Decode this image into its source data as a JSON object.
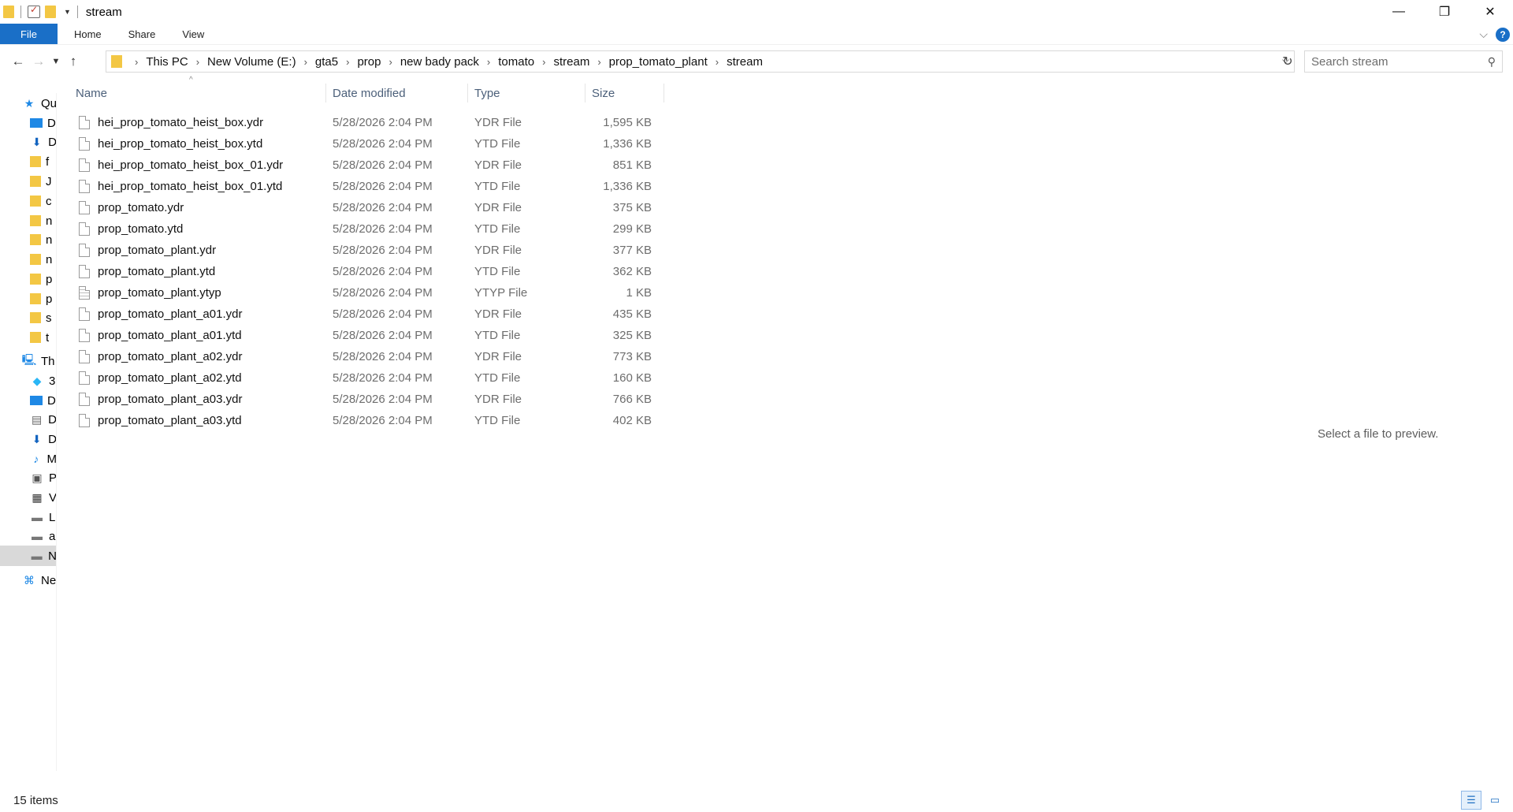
{
  "window": {
    "title": "stream"
  },
  "ribbon": {
    "tabs": [
      "File",
      "Home",
      "Share",
      "View"
    ]
  },
  "address": {
    "crumbs": [
      "This PC",
      "New Volume (E:)",
      "gta5",
      "prop",
      "new bady pack",
      "tomato",
      "stream",
      "prop_tomato_plant",
      "stream"
    ]
  },
  "search": {
    "placeholder": "Search stream"
  },
  "nav": {
    "items": [
      {
        "label": "Qu",
        "icon": "star-icon"
      },
      {
        "label": "D",
        "icon": "desktop-icon"
      },
      {
        "label": "D",
        "icon": "download-icon"
      },
      {
        "label": "f",
        "icon": "folder-icon"
      },
      {
        "label": "J",
        "icon": "folder-icon"
      },
      {
        "label": "c",
        "icon": "folder-icon"
      },
      {
        "label": "n",
        "icon": "folder-icon"
      },
      {
        "label": "n",
        "icon": "folder-icon"
      },
      {
        "label": "n",
        "icon": "folder-icon"
      },
      {
        "label": "p",
        "icon": "folder-icon"
      },
      {
        "label": "p",
        "icon": "folder-icon"
      },
      {
        "label": "s",
        "icon": "folder-icon"
      },
      {
        "label": "t",
        "icon": "folder-icon"
      },
      {
        "label": "Th",
        "icon": "pc-icon"
      },
      {
        "label": "3",
        "icon": "cube-icon"
      },
      {
        "label": "D",
        "icon": "desktop-icon"
      },
      {
        "label": "D",
        "icon": "document-icon"
      },
      {
        "label": "D",
        "icon": "download-icon"
      },
      {
        "label": "M",
        "icon": "music-icon"
      },
      {
        "label": "P",
        "icon": "pictures-icon"
      },
      {
        "label": "V",
        "icon": "video-icon"
      },
      {
        "label": "L",
        "icon": "drive-icon"
      },
      {
        "label": "a",
        "icon": "drive-icon"
      },
      {
        "label": "N",
        "icon": "drive-icon"
      },
      {
        "label": "Ne",
        "icon": "network-icon"
      }
    ]
  },
  "columns": [
    "Name",
    "Date modified",
    "Type",
    "Size"
  ],
  "files": [
    {
      "name": "hei_prop_tomato_heist_box.ydr",
      "date": "5/28/2026 2:04 PM",
      "type": "YDR File",
      "size": "1,595 KB"
    },
    {
      "name": "hei_prop_tomato_heist_box.ytd",
      "date": "5/28/2026 2:04 PM",
      "type": "YTD File",
      "size": "1,336 KB"
    },
    {
      "name": "hei_prop_tomato_heist_box_01.ydr",
      "date": "5/28/2026 2:04 PM",
      "type": "YDR File",
      "size": "851 KB"
    },
    {
      "name": "hei_prop_tomato_heist_box_01.ytd",
      "date": "5/28/2026 2:04 PM",
      "type": "YTD File",
      "size": "1,336 KB"
    },
    {
      "name": "prop_tomato.ydr",
      "date": "5/28/2026 2:04 PM",
      "type": "YDR File",
      "size": "375 KB"
    },
    {
      "name": "prop_tomato.ytd",
      "date": "5/28/2026 2:04 PM",
      "type": "YTD File",
      "size": "299 KB"
    },
    {
      "name": "prop_tomato_plant.ydr",
      "date": "5/28/2026 2:04 PM",
      "type": "YDR File",
      "size": "377 KB"
    },
    {
      "name": "prop_tomato_plant.ytd",
      "date": "5/28/2026 2:04 PM",
      "type": "YTD File",
      "size": "362 KB"
    },
    {
      "name": "prop_tomato_plant.ytyp",
      "date": "5/28/2026 2:04 PM",
      "type": "YTYP File",
      "size": "1 KB"
    },
    {
      "name": "prop_tomato_plant_a01.ydr",
      "date": "5/28/2026 2:04 PM",
      "type": "YDR File",
      "size": "435 KB"
    },
    {
      "name": "prop_tomato_plant_a01.ytd",
      "date": "5/28/2026 2:04 PM",
      "type": "YTD File",
      "size": "325 KB"
    },
    {
      "name": "prop_tomato_plant_a02.ydr",
      "date": "5/28/2026 2:04 PM",
      "type": "YDR File",
      "size": "773 KB"
    },
    {
      "name": "prop_tomato_plant_a02.ytd",
      "date": "5/28/2026 2:04 PM",
      "type": "YTD File",
      "size": "160 KB"
    },
    {
      "name": "prop_tomato_plant_a03.ydr",
      "date": "5/28/2026 2:04 PM",
      "type": "YDR File",
      "size": "766 KB"
    },
    {
      "name": "prop_tomato_plant_a03.ytd",
      "date": "5/28/2026 2:04 PM",
      "type": "YTD File",
      "size": "402 KB"
    }
  ],
  "preview": {
    "message": "Select a file to preview."
  },
  "status": {
    "items": "15 items"
  },
  "colors": {
    "accent": "#1a6fc7"
  }
}
